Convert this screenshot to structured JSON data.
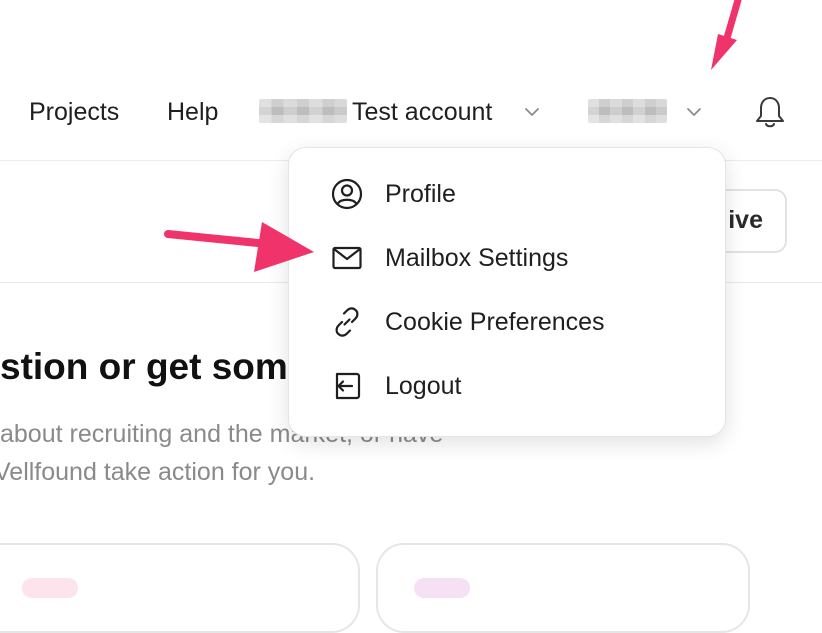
{
  "nav": {
    "projects": "Projects",
    "help": "Help",
    "account": "Test account"
  },
  "side_button": {
    "label_fragment": "ive"
  },
  "content": {
    "headline": "stion or get som",
    "line1": "about recruiting and the market, or have",
    "line2": "Vellfound take action for you."
  },
  "menu": {
    "items": [
      {
        "label": "Profile",
        "icon": "user-circle-icon"
      },
      {
        "label": "Mailbox Settings",
        "icon": "mail-icon"
      },
      {
        "label": "Cookie Preferences",
        "icon": "link-icon"
      },
      {
        "label": "Logout",
        "icon": "logout-icon"
      }
    ]
  },
  "colors": {
    "annotation_arrow": "#f0336b",
    "text_primary": "#1f1f1f",
    "text_muted": "#8a8a8a",
    "menu_border": "#e5e5e5"
  }
}
